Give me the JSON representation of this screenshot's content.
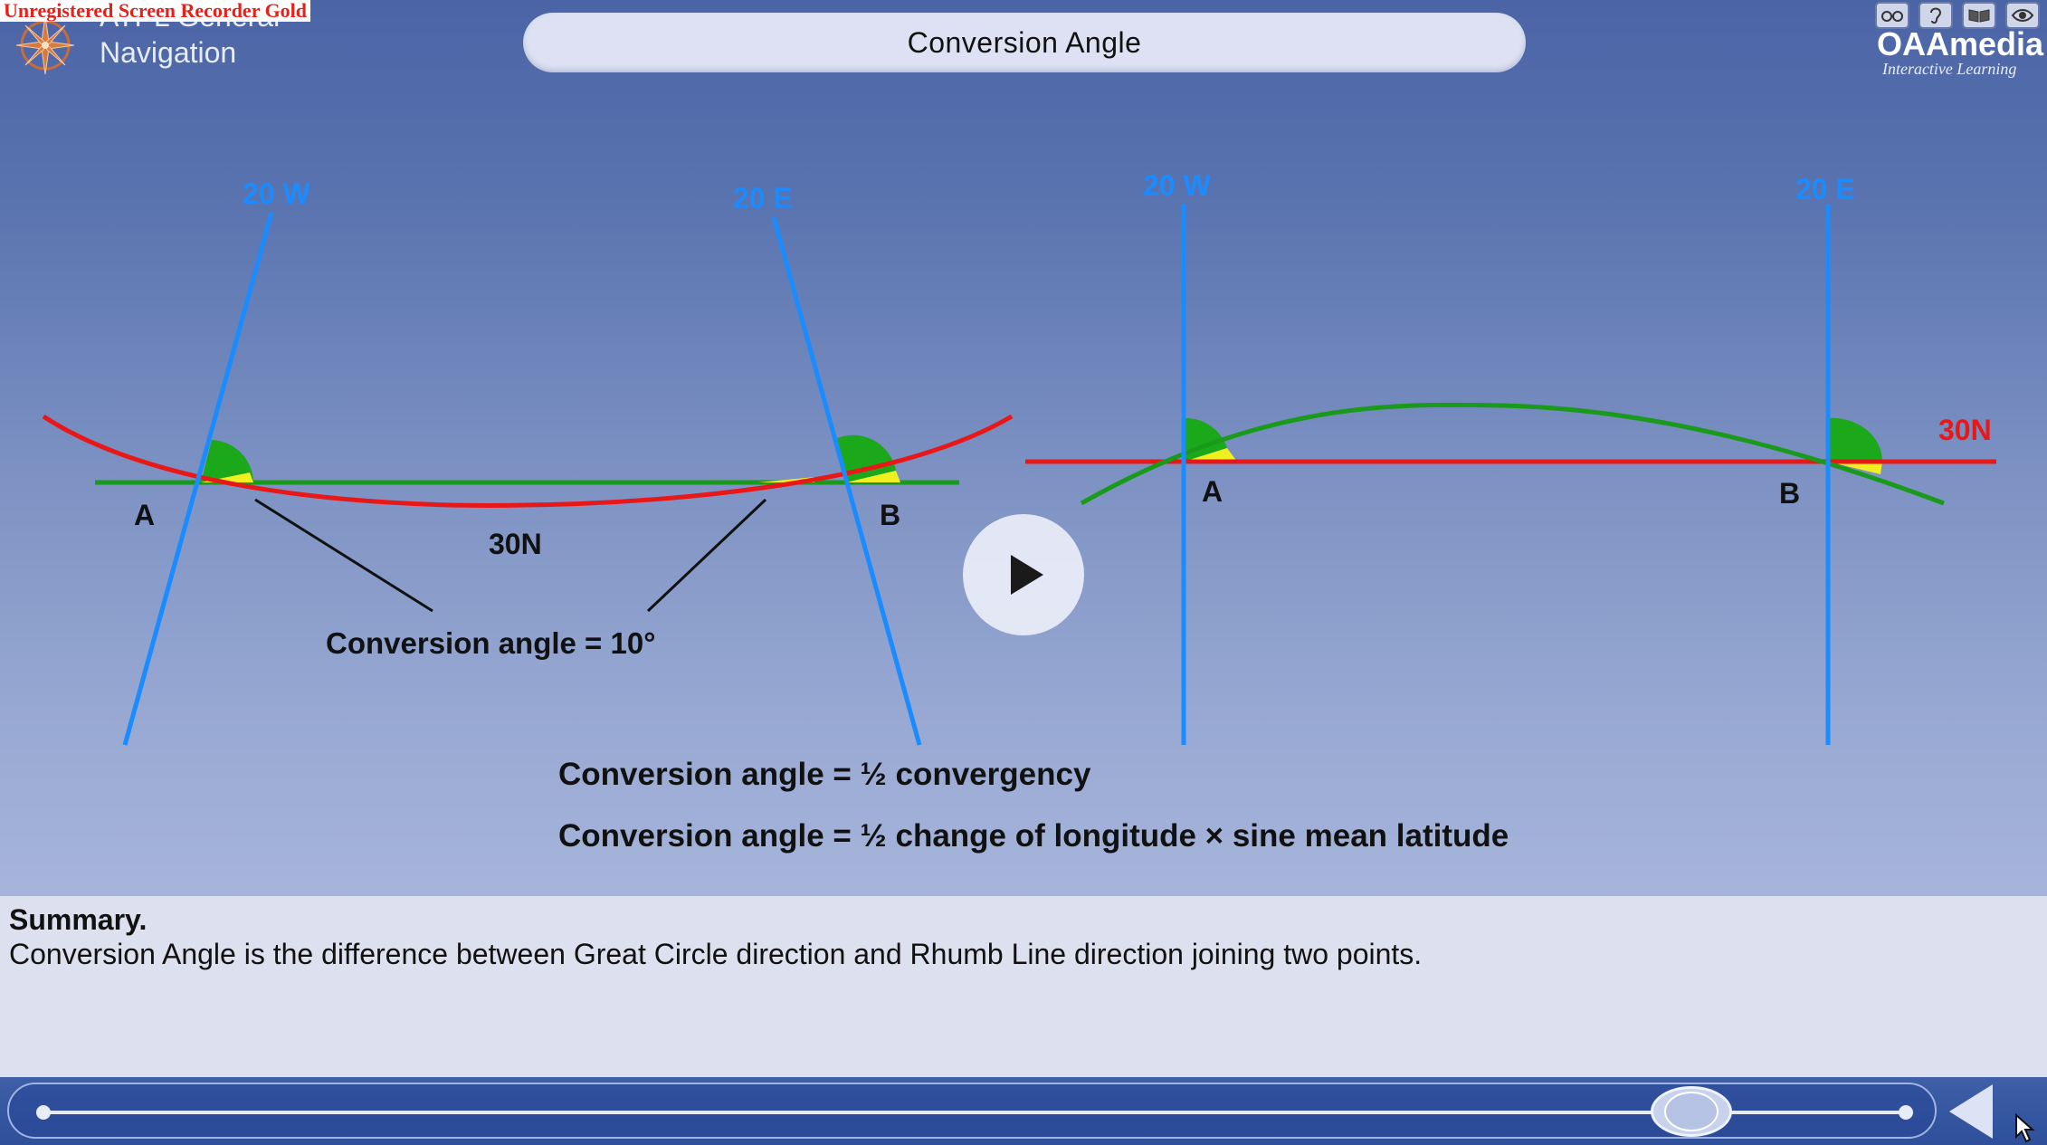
{
  "watermark": "Unregistered Screen Recorder Gold",
  "course": {
    "line1": "ATPL General",
    "line2": "Navigation"
  },
  "title": "Conversion Angle",
  "brand": {
    "name": "OAAmedia",
    "tagline": "Interactive Learning"
  },
  "tool_icons": [
    "glasses-icon",
    "ear-icon",
    "book-icon",
    "eye-icon"
  ],
  "diagram_left": {
    "meridian_west_label": "20 W",
    "meridian_east_label": "20 E",
    "point_a": "A",
    "point_b": "B",
    "parallel_label": "30N",
    "conversion_note": "Conversion angle = 10°"
  },
  "diagram_right": {
    "meridian_west_label": "20 W",
    "meridian_east_label": "20 E",
    "point_a": "A",
    "point_b": "B",
    "parallel_label": "30N"
  },
  "colors": {
    "meridian": "#1a8cff",
    "great_circle": "#e81818",
    "rhumb_line": "#1a9a1a",
    "angle_fill": "#1ba81b",
    "angle_small": "#f0f020"
  },
  "formulas": {
    "line1": "Conversion angle = ½ convergency",
    "line2": "Conversion angle = ½ change of longitude × sine mean latitude"
  },
  "summary": {
    "heading": "Summary.",
    "text": "Conversion Angle is the difference between Great Circle direction and Rhumb Line direction joining two points."
  },
  "player": {
    "progress": 0.87
  }
}
